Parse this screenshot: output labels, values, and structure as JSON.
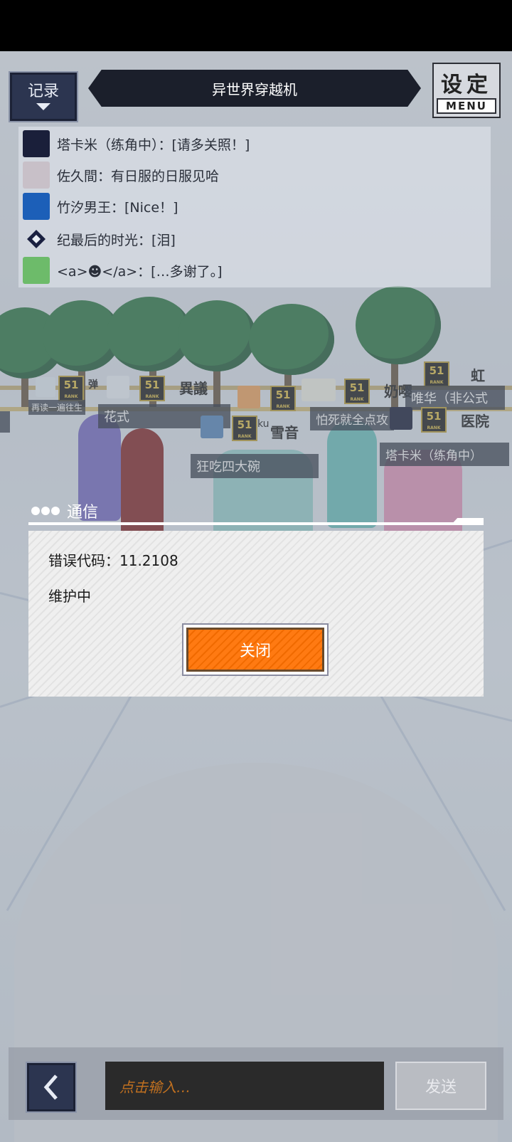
{
  "header": {
    "log_button": "记录",
    "title": "异世界穿越机",
    "menu_big": "设定",
    "menu_small": "MENU"
  },
  "chat_log": [
    {
      "text": "塔卡米（练角中）：[请多关照！]",
      "avatar_color": "#1a1f3a"
    },
    {
      "text": "佐久間：有日服的日服见哈",
      "avatar_color": "#c8c0c8"
    },
    {
      "text": "竹汐男王：[Nice！]",
      "avatar_color": "#1c5fb8"
    },
    {
      "text": "纪最后的时光：[泪]",
      "avatar_color": "#e9eef4"
    },
    {
      "text": "<a>☻</a>：[…多谢了。]",
      "avatar_color": "#6dbb6a"
    }
  ],
  "scene_names": {
    "n1": "再读一遍往生",
    "n2": "弹",
    "n3": "異議",
    "n4": "花式",
    "n5": "ku",
    "n6": "雪音",
    "n7": "怕死就全点攻",
    "n8": "奶嘤",
    "n9": "虹",
    "n10": "唯华（非公式",
    "n11": "医院",
    "n12": "狂吃四大碗",
    "n13": "塔卡米（练角中）",
    "rank": "51",
    "rank_sub": "RANK"
  },
  "dialog": {
    "title": "通信",
    "error_code": "错误代码：11.2108",
    "message": "维护中",
    "close_button": "关闭"
  },
  "bottom": {
    "back_icon": "chevron-left-icon",
    "input_placeholder": "点击输入…",
    "send_button": "发送"
  }
}
